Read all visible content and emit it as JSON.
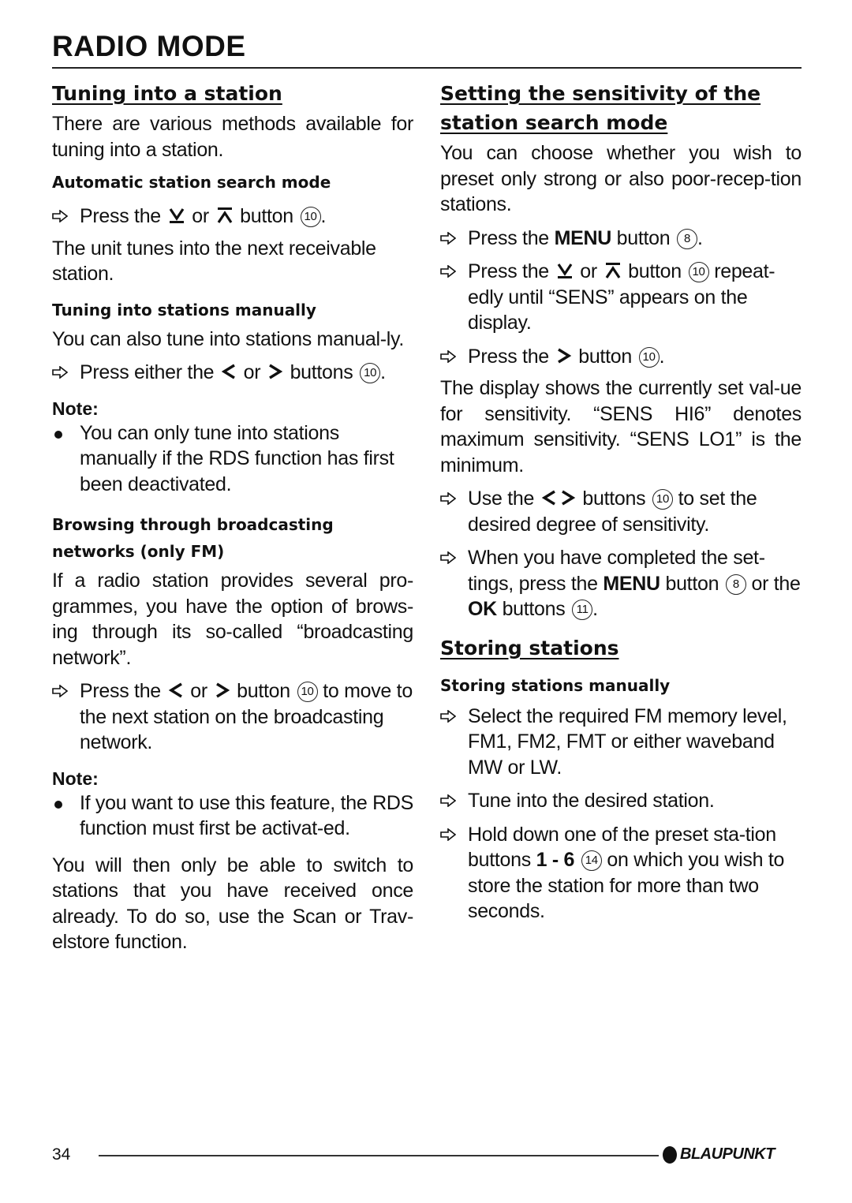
{
  "page": {
    "title": "RADIO MODE",
    "page_number": "34",
    "brand": "BLAUPUNKT"
  },
  "left": {
    "h_tuning": "Tuning into a station",
    "intro": "There are various methods available for tuning into a station.",
    "h_auto": "Automatic station search mode",
    "auto_step": {
      "pre": "Press the",
      "mid": "or",
      "post": "button",
      "num": "10",
      "end": "."
    },
    "auto_result": "The unit tunes into the next receivable station.",
    "h_manual": "Tuning into stations manually",
    "manual_intro": "You can also tune into stations manual-ly.",
    "manual_step": {
      "pre": "Press either the",
      "mid": "or",
      "post": "buttons",
      "num": "10",
      "end": "."
    },
    "note1_label": "Note:",
    "note1_text": "You can only tune into stations manually if the RDS function has first been deactivated.",
    "h_browse": "Browsing through broadcasting networks (only FM)",
    "browse_text": "If a radio station provides several pro-grammes, you have the option of brows-ing through its so-called “broadcasting network”.",
    "browse_step": {
      "pre": "Press the",
      "mid": "or",
      "post": "button",
      "num": "10",
      "end": "to move to the next station on the broadcasting network."
    },
    "note2_label": "Note:",
    "note2_text": "If you want to use this feature, the RDS function must first be activat-ed.",
    "closing": "You will then only be able to switch to stations that you have received once already. To do so, use the Scan or Trav-elstore function."
  },
  "right": {
    "h_sens": "Setting the sensitivity of the station search mode",
    "sens_intro": "You can choose whether you wish to preset only strong or also poor-recep-tion stations.",
    "step1": {
      "pre": "Press the",
      "bold": "MENU",
      "post": "button",
      "num": "8",
      "end": "."
    },
    "step2": {
      "pre": "Press the",
      "mid": "or",
      "post": "button",
      "num": "10",
      "end": "repeat-edly until “SENS” appears on the display."
    },
    "step3": {
      "pre": "Press the",
      "post": "button",
      "num": "10",
      "end": "."
    },
    "sens_desc": "The display shows the currently set val-ue for sensitivity. “SENS HI6” denotes maximum sensitivity. “SENS LO1” is the minimum.",
    "step4": {
      "pre": "Use the",
      "post": "buttons",
      "num": "10",
      "end": "to set the desired degree of sensitivity."
    },
    "step5": {
      "pre": "When you have completed the set-tings, press the",
      "bold": "MENU",
      "post": "button",
      "num": "8",
      "mid": "or the",
      "bold2": "OK",
      "post2": "buttons",
      "num2": "11",
      "end": "."
    },
    "h_store": "Storing stations",
    "h_store_manual": "Storing stations manually",
    "store1": "Select the required FM memory level, FM1, FM2, FMT or either waveband MW or LW.",
    "store2": "Tune into the desired station.",
    "store3": {
      "pre": "Hold down one of the preset sta-tion buttons",
      "bold": "1 - 6",
      "num": "14",
      "end": "on which you wish to store the station for more than two seconds."
    }
  },
  "icons": {
    "step_arrow": "hollow-right-arrow-icon",
    "down_button": "seek-down-icon",
    "up_button": "seek-up-icon",
    "left_button": "left-chevron-icon",
    "right_button": "right-chevron-icon",
    "note_bullet": "bullet-dot-icon",
    "brand_logo": "blaupunkt-dot-icon"
  }
}
